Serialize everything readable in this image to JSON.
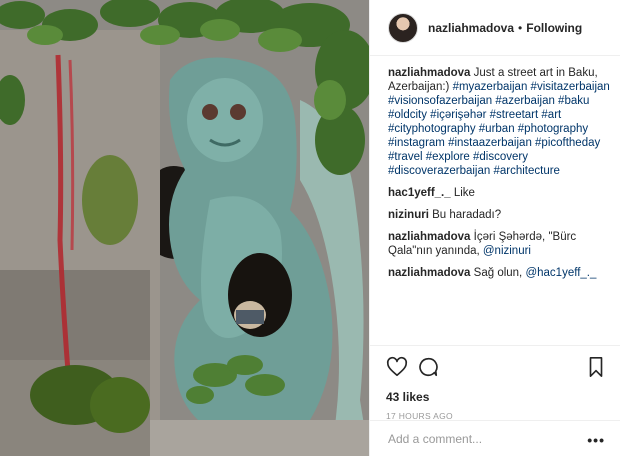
{
  "post": {
    "username": "nazliahmadova",
    "follow_status": "Following",
    "separator": "•"
  },
  "comments": [
    {
      "author": "nazliahmadova",
      "text": "Just a street art in Baku, Azerbaijan:) ",
      "tags": "#myazerbaijan #visitazerbaijan #visionsofazerbaijan #azerbaijan #baku #oldcity #içərişəhər #streetart #art #cityphotography #urban #photography #instagram #instaazerbaijan #picoftheday #travel #explore #discovery #discoverazerbaijan #architecture"
    },
    {
      "author": "hac1yeff_._",
      "text": "Like",
      "tags": ""
    },
    {
      "author": "nizinuri",
      "text": "Bu haradadı?",
      "tags": ""
    },
    {
      "author": "nazliahmadova",
      "text": "İçəri Şəhərdə, \"Bürc Qala\"nın yanında, ",
      "tags": "@nizinuri"
    },
    {
      "author": "nazliahmadova",
      "text": "Sağ olun, ",
      "tags": "@hac1yeff_._"
    }
  ],
  "actions": {
    "likes": "43 likes",
    "timestamp": "17 HOURS AGO"
  },
  "add_comment": {
    "placeholder": "Add a comment...",
    "more": "•••"
  },
  "icons": {
    "like": "heart-icon",
    "comment": "comment-icon",
    "save": "bookmark-icon",
    "more": "more-options-icon"
  }
}
